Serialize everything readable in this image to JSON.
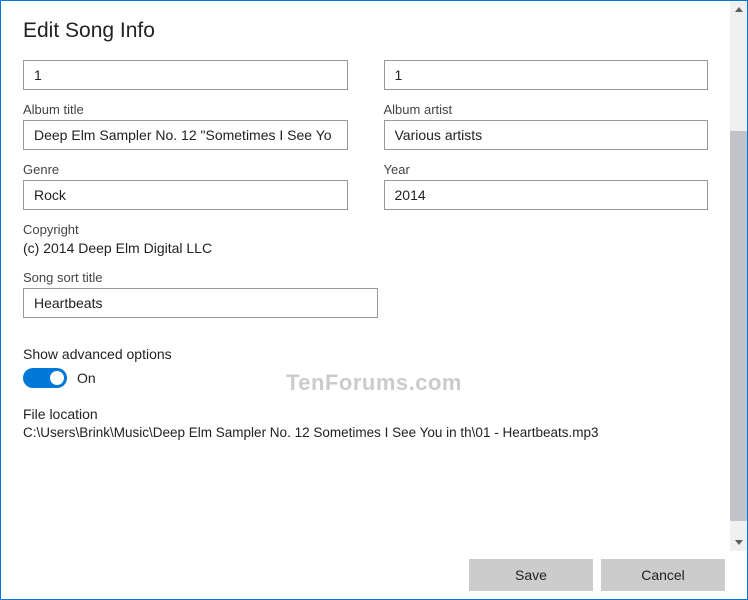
{
  "title": "Edit Song Info",
  "row1": {
    "left": "1",
    "right": "1"
  },
  "album": {
    "title_label": "Album title",
    "title_value": "Deep Elm Sampler No. 12 \"Sometimes I See Yo",
    "artist_label": "Album artist",
    "artist_value": "Various artists"
  },
  "genre": {
    "label": "Genre",
    "value": "Rock"
  },
  "year": {
    "label": "Year",
    "value": "2014"
  },
  "copyright": {
    "label": "Copyright",
    "value": "(c) 2014 Deep Elm Digital LLC"
  },
  "sort_title": {
    "label": "Song sort title",
    "value": "Heartbeats"
  },
  "advanced": {
    "label": "Show advanced options",
    "state": "On"
  },
  "file": {
    "label": "File location",
    "path": "C:\\Users\\Brink\\Music\\Deep Elm Sampler No. 12 Sometimes I See You in th\\01 - Heartbeats.mp3"
  },
  "buttons": {
    "save": "Save",
    "cancel": "Cancel"
  },
  "watermark": "TenForums.com"
}
